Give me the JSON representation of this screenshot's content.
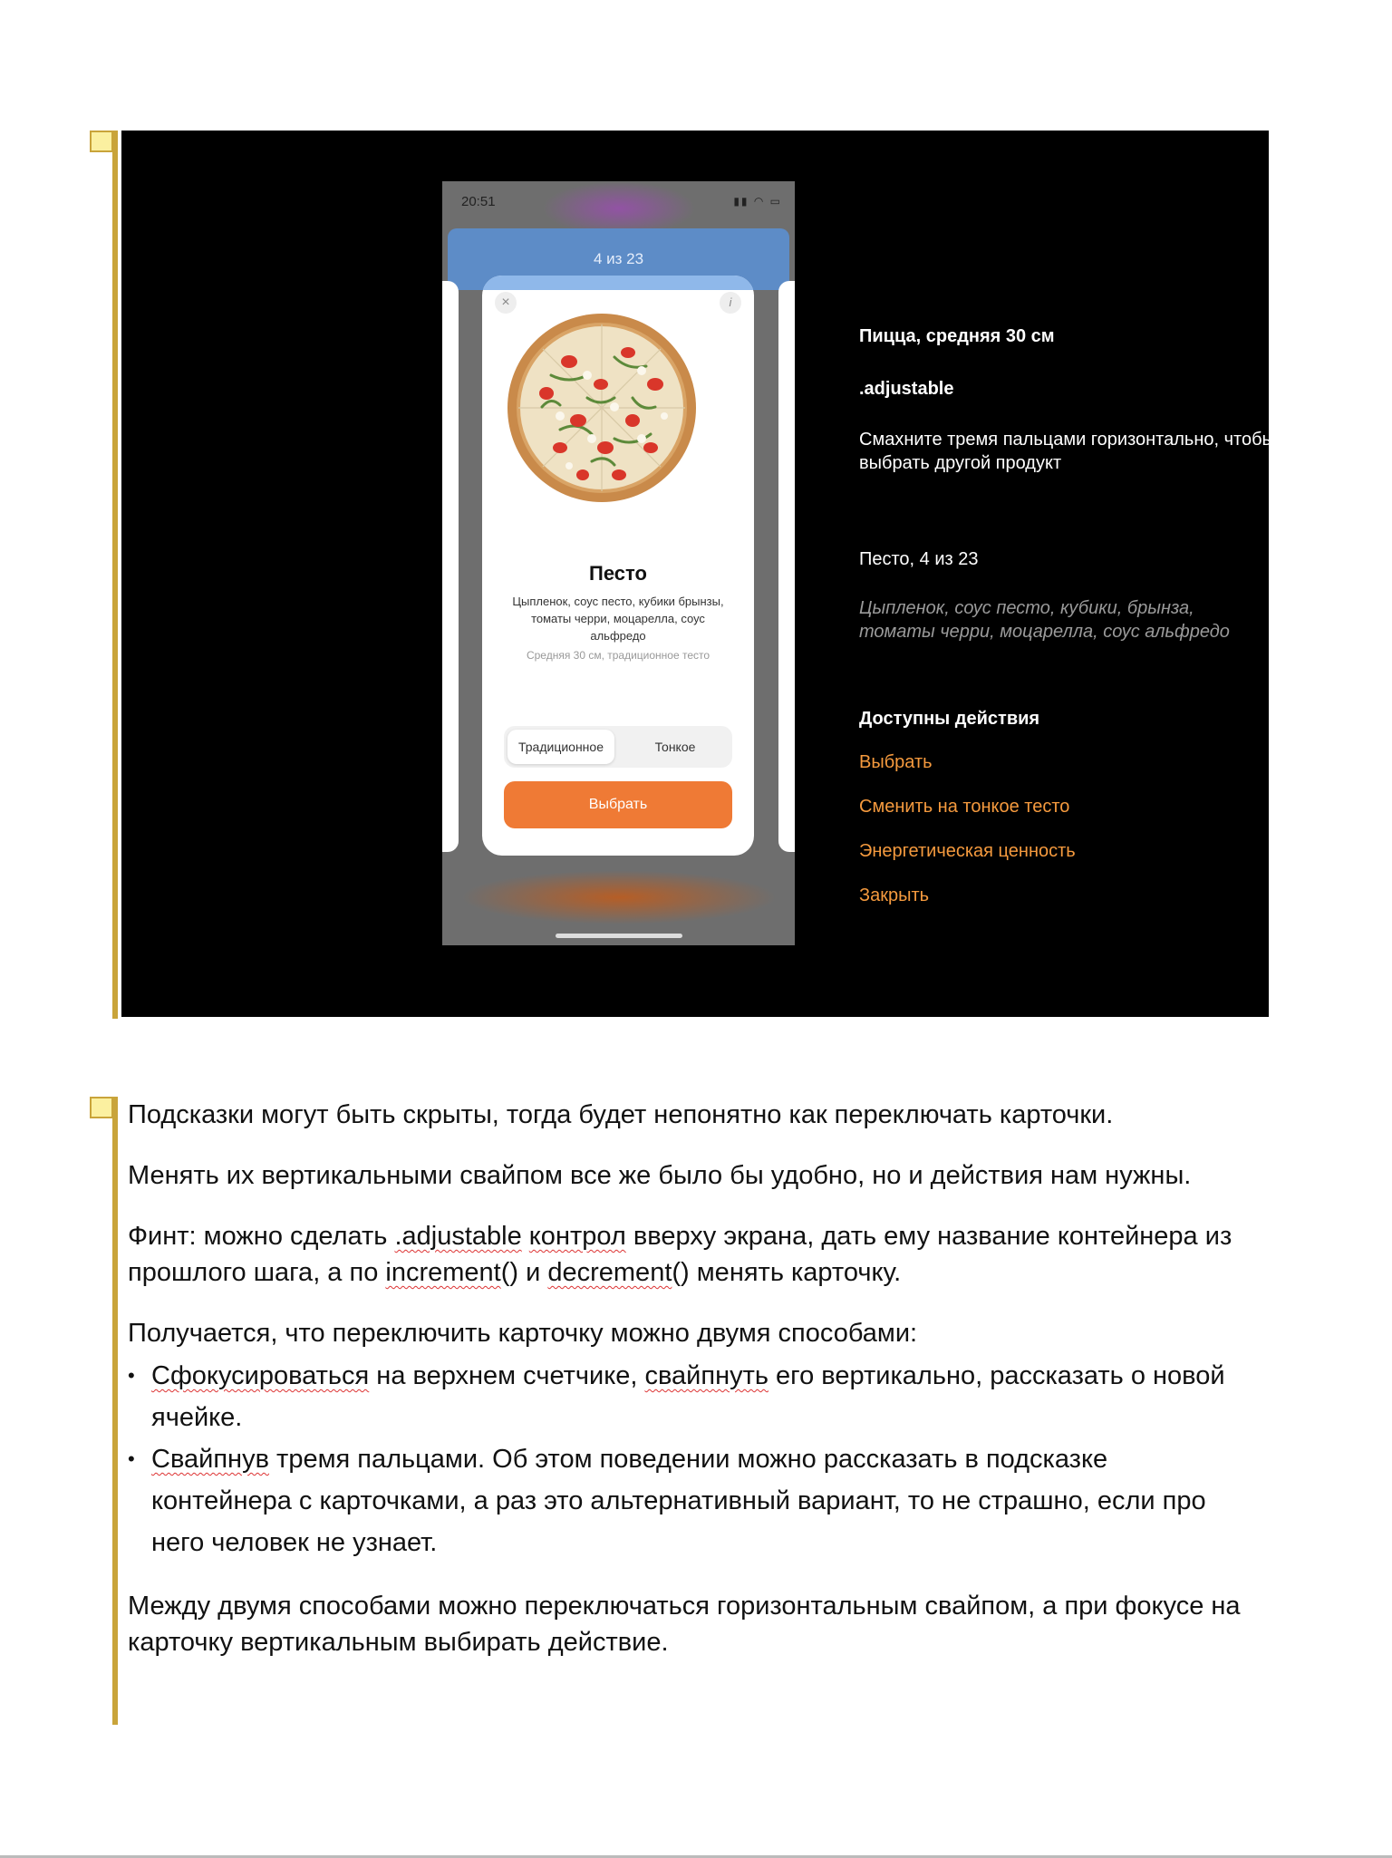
{
  "phone": {
    "status_time": "20:51",
    "counter": "4 из 23",
    "card": {
      "title": "Песто",
      "description": "Цыпленок, соус песто, кубики брынзы, томаты черри, моцарелла, соус альфредо",
      "size": "Средняя 30 см, традиционное тесто",
      "dough_options": [
        "Традиционное",
        "Тонкое"
      ],
      "selected_dough": "Традиционное",
      "select_button": "Выбрать",
      "close_icon": "×",
      "info_icon": "i"
    }
  },
  "accessibility": {
    "container_label": "Пицца, средняя 30 см",
    "trait": ".adjustable",
    "hint": "Смахните тремя пальцами горизонтально, чтобы выбрать другой продукт",
    "value": "Песто, 4 из 23",
    "description": "Цыпленок, соус песто, кубики, брынза, томаты черри, моцарелла, соус альфредо",
    "actions_title": "Доступны действия",
    "actions": [
      "Выбрать",
      "Сменить на тонкое тесто",
      "Энергетическая ценность",
      "Закрыть"
    ]
  },
  "notes": {
    "p1": "Подсказки могут быть скрыты, тогда будет непонятно как переключать карточки.",
    "p2": "Менять их вертикальными свайпом все же было бы удобно, но и действия нам нужны.",
    "p3_a": "Финт: можно сделать ",
    "p3_b": ".adjustable",
    "p3_c": " ",
    "p3_d": "контрол",
    "p3_e": " вверху экрана, дать ему название контейнера из прошлого шага, а по ",
    "p3_f": "increment",
    "p3_g": "() и ",
    "p3_h": "decrement",
    "p3_i": "() менять карточку.",
    "p4": "Получается, что переключить карточку можно двумя способами:",
    "li1_a": "Сфокусироваться",
    "li1_b": " на верхнем счетчике, ",
    "li1_c": "свайпнуть",
    "li1_d": " его вертикально, рассказать о новой ячейке.",
    "li2_a": "Свайпнув",
    "li2_b": " тремя пальцами. Об этом поведении можно рассказать в подсказке контейнера с карточками, а раз это альтернативный вариант, то не страшно, если про него человек не узнает.",
    "p5": "Между двумя способами можно переключаться горизонтальным свайпом, а при фокусе на карточку вертикальным выбирать действие."
  },
  "colors": {
    "accent_orange": "#ef7a35",
    "action_orange": "#f59a3e",
    "counter_blue": "#5d8cc7",
    "note_marker": "#fbf0a0",
    "note_bar": "#c9a43a"
  }
}
